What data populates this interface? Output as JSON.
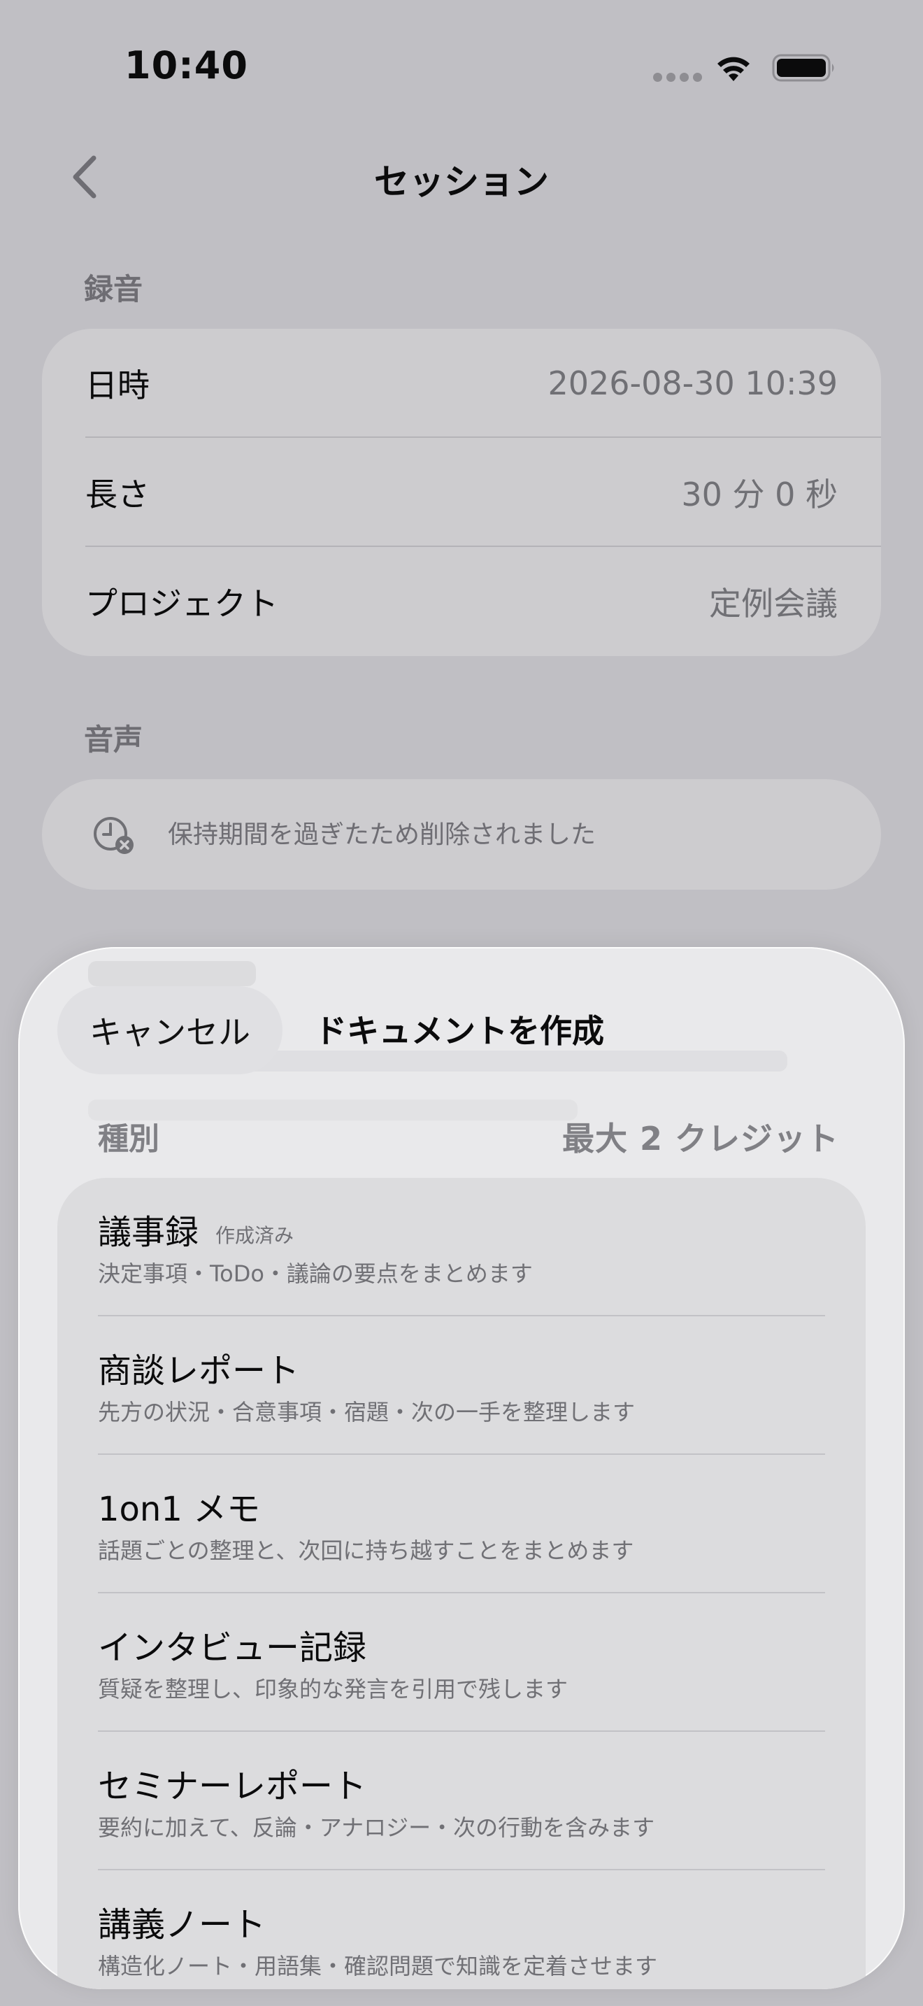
{
  "status_bar": {
    "time": "10:40"
  },
  "nav": {
    "title": "セッション"
  },
  "recording": {
    "header": "録音",
    "rows": [
      {
        "label": "日時",
        "value": "2026-08-30 10:39"
      },
      {
        "label": "長さ",
        "value": "30 分 0 秒"
      },
      {
        "label": "プロジェクト",
        "value": "定例会議"
      }
    ]
  },
  "audio": {
    "header": "音声",
    "message": "保持期間を過ぎたため削除されました",
    "icon": "clock-deleted-icon"
  },
  "sheet": {
    "cancel_label": "キャンセル",
    "title": "ドキュメントを作成",
    "kind_label": "種別",
    "credit_label": "最大 2 クレジット",
    "items": [
      {
        "title": "議事録",
        "tag": "作成済み",
        "desc": "決定事項・ToDo・議論の要点をまとめます"
      },
      {
        "title": "商談レポート",
        "tag": "",
        "desc": "先方の状況・合意事項・宿題・次の一手を整理します"
      },
      {
        "title": "1on1 メモ",
        "tag": "",
        "desc": "話題ごとの整理と、次回に持ち越すことをまとめます"
      },
      {
        "title": "インタビュー記録",
        "tag": "",
        "desc": "質疑を整理し、印象的な発言を引用で残します"
      },
      {
        "title": "セミナーレポート",
        "tag": "",
        "desc": "要約に加えて、反論・アナロジー・次の行動を含みます"
      },
      {
        "title": "講義ノート",
        "tag": "",
        "desc": "構造化ノート・用語集・確認問題で知識を定着させます"
      }
    ]
  }
}
